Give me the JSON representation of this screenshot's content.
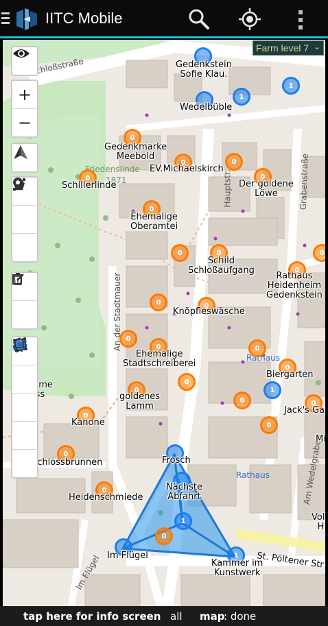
{
  "app": {
    "title": "IITC Mobile"
  },
  "farm": {
    "label": "Farm level 7"
  },
  "statusbar": {
    "info": "tap here for info screen",
    "filter": "all",
    "map_key": "map",
    "map_value": ": done"
  },
  "toolbar": {
    "zoom_in": "+",
    "zoom_out": "−"
  },
  "colors": {
    "resistance": "#1b7feb",
    "neutral": "#ff7a00",
    "accent": "#22c1d8"
  },
  "icons": [
    "menu-icon",
    "iitc-logo-icon",
    "search-icon",
    "locate-icon",
    "more-icon",
    "eye-icon",
    "compass-icon",
    "draw-line-icon",
    "draw-polygon-icon",
    "draw-marker-icon",
    "edit-icon",
    "trash-icon",
    "layers-icon",
    "portal-highlight-icon",
    "link-icon",
    "polygon-select-icon",
    "bell-icon"
  ],
  "portals": [
    {
      "level": "",
      "faction": "res"
    },
    {
      "level": "1",
      "faction": "res"
    },
    {
      "level": "1",
      "faction": "res"
    },
    {
      "level": "0",
      "faction": "neu"
    },
    {
      "level": "0",
      "faction": "neu"
    },
    {
      "level": "0",
      "faction": "neu"
    },
    {
      "level": "0",
      "faction": "neu"
    },
    {
      "level": "0",
      "faction": "neu"
    },
    {
      "level": "0",
      "faction": "neu"
    },
    {
      "level": "0",
      "faction": "neu"
    },
    {
      "level": "0",
      "faction": "neu"
    },
    {
      "level": "0",
      "faction": "neu"
    },
    {
      "level": "0",
      "faction": "neu"
    },
    {
      "level": "0",
      "faction": "neu"
    },
    {
      "level": "0",
      "faction": "neu"
    },
    {
      "level": "0",
      "faction": "neu"
    },
    {
      "level": "0",
      "faction": "neu"
    },
    {
      "level": "0",
      "faction": "neu"
    },
    {
      "level": "0",
      "faction": "neu"
    },
    {
      "level": "0",
      "faction": "neu"
    },
    {
      "level": "1",
      "faction": "res"
    },
    {
      "level": "0",
      "faction": "neu"
    },
    {
      "level": "0",
      "faction": "neu"
    },
    {
      "level": "0",
      "faction": "neu"
    },
    {
      "level": "0",
      "faction": "neu"
    },
    {
      "level": "0",
      "faction": "neu"
    },
    {
      "level": "",
      "faction": "res"
    },
    {
      "level": "",
      "faction": "res"
    },
    {
      "level": "1",
      "faction": "res"
    },
    {
      "level": "0",
      "faction": "neu"
    },
    {
      "level": "",
      "faction": "res"
    },
    {
      "level": "1",
      "faction": "res"
    },
    {
      "level": "0",
      "faction": "neu"
    }
  ],
  "labels": [
    "Gedenkstein\nSofie Klau.",
    "Wedelbüble",
    "Gedenkmarke\nMeebold",
    "EV.Michaelskirch",
    "Schillerlinde",
    "Der goldene\nLöwe",
    "Ehemalige\nOberamtei",
    "Schild\nSchloßaufgang",
    "Rathaus\nHeidenheim\nGedenkstein",
    "Knöpfleswäsche",
    "Ehemalige\nStadtschreiberei",
    "goldenes\nLamm",
    "Biergarten",
    "Jack's Ga",
    "Kanone",
    "Schlossbrunnen",
    "Frosch",
    "Nächste\nAbfahrt",
    "Heidenschmiede",
    "Im Flügel",
    "Kammer im\nKunstwerk",
    "ahme\nloss",
    "Volk\nH",
    "Mi"
  ],
  "streets": [
    "Schloßstraße",
    "Hauptstr.",
    "Grabenstraße",
    "An der Stadtmauer",
    "Am Wedelgraben",
    "St. Pöltener Str",
    "Im Flügel",
    "Rathaus",
    "Rathaus",
    "Friedenslinde",
    "1871"
  ]
}
